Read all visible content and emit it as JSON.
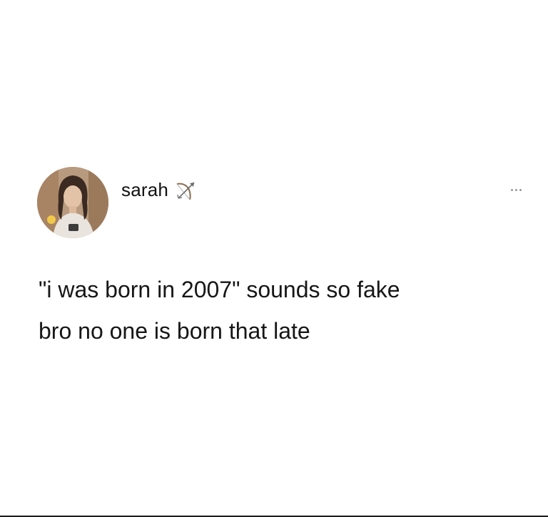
{
  "post": {
    "author": {
      "name": "sarah",
      "avatar_icon": "profile-photo",
      "badge_icon": "bow-and-arrow-icon"
    },
    "more_icon": "ellipsis-icon",
    "text_lines": [
      "\"i was born in 2007\" sounds so fake",
      "bro no one is born that late"
    ]
  },
  "colors": {
    "background": "#ffffff",
    "text": "#161616",
    "muted": "#9a9a9a"
  }
}
